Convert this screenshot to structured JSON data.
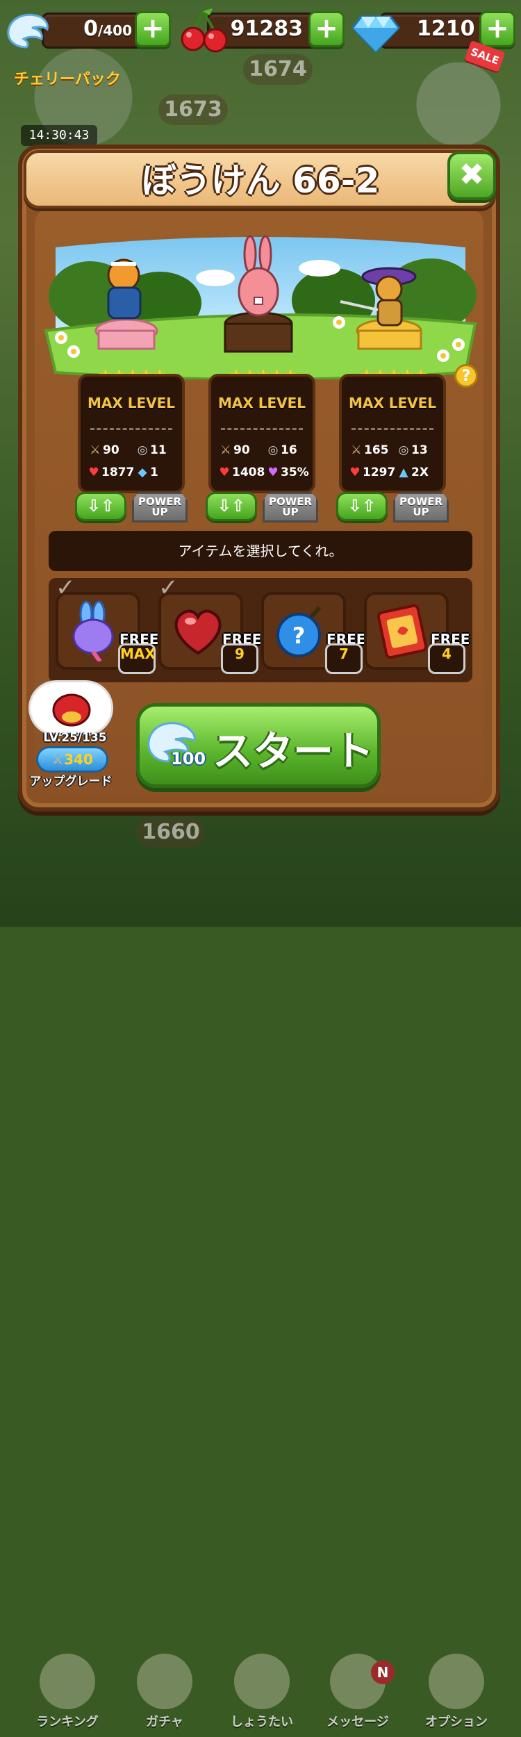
{
  "topbar": {
    "hearts": "0",
    "hearts_max": "/400",
    "cherries": "91283",
    "gems": "1210",
    "sale_label": "SALE",
    "plus_label": "+"
  },
  "background": {
    "stage_a": "1674",
    "stage_b": "1673",
    "stage_c": "1660",
    "timer": "14:30:43",
    "banner": "チェリーパック"
  },
  "dialog": {
    "title": "ぼうけん 66-2",
    "close_label": "✖",
    "help_label": "?",
    "hint": "アイテムを選択してくれ。"
  },
  "characters": [
    {
      "stars": "★★★★★",
      "level_label": "MAX LEVEL",
      "attack": "90",
      "coins": "11",
      "hp": "1877",
      "skill": "1",
      "swap": "⇩⇧",
      "power_line1": "POWER",
      "power_line2": "UP"
    },
    {
      "stars": "★★★★★",
      "level_label": "MAX LEVEL",
      "attack": "90",
      "coins": "16",
      "hp": "1408",
      "skill": "35%",
      "swap": "⇩⇧",
      "power_line1": "POWER",
      "power_line2": "UP"
    },
    {
      "stars": "★★★★★",
      "level_label": "MAX LEVEL",
      "attack": "165",
      "coins": "13",
      "hp": "1297",
      "skill": "2X",
      "swap": "⇩⇧",
      "power_line1": "POWER",
      "power_line2": "UP"
    }
  ],
  "items": [
    {
      "free": "FREE",
      "count": "MAX",
      "icon": "bunny-balloon-icon"
    },
    {
      "free": "FREE",
      "count": "9",
      "icon": "heart-potion-icon"
    },
    {
      "free": "FREE",
      "count": "7",
      "icon": "mystery-bomb-icon"
    },
    {
      "free": "FREE",
      "count": "4",
      "icon": "spell-book-icon"
    }
  ],
  "upgrade": {
    "level": "LV.25/135",
    "cost": "340",
    "label": "アップグレード"
  },
  "start": {
    "label": "スタート",
    "cost": "100"
  },
  "nav": [
    {
      "label": "ランキング",
      "icon": "trophy-icon"
    },
    {
      "label": "ガチャ",
      "icon": "gacha-icon"
    },
    {
      "label": "しょうたい",
      "icon": "invite-icon"
    },
    {
      "label": "メッセージ",
      "icon": "mail-icon",
      "badge": "N"
    },
    {
      "label": "オプション",
      "icon": "gear-icon"
    }
  ],
  "colors": {
    "panel": "#8a5224",
    "accent_green": "#59b42b",
    "gold": "#f3c444"
  }
}
